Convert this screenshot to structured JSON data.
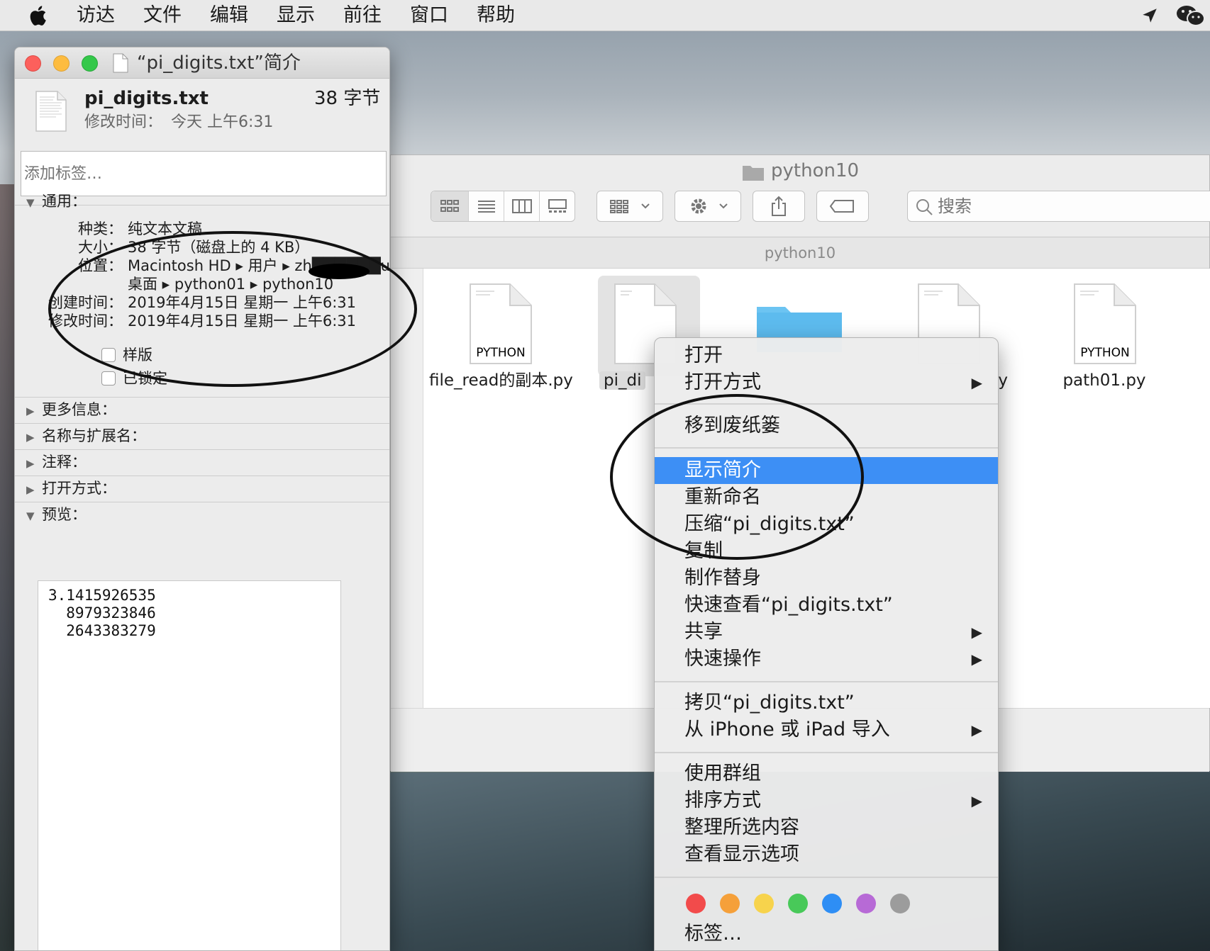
{
  "menubar": {
    "items": [
      "访达",
      "文件",
      "编辑",
      "显示",
      "前往",
      "窗口",
      "帮助"
    ]
  },
  "info_window": {
    "title": "“pi_digits.txt”简介",
    "file_name": "pi_digits.txt",
    "file_size": "38 字节",
    "modified_label": "修改时间：",
    "modified_value": "今天 上午6:31",
    "tag_placeholder": "添加标签…",
    "general": {
      "header": "通用：",
      "rows": [
        {
          "label": "种类：",
          "value": "纯文本文稿"
        },
        {
          "label": "大小：",
          "value": "38 字节（磁盘上的 4 KB）"
        },
        {
          "label": "位置：",
          "value": "Macintosh HD ▸ 用户 ▸ zh██████u ▸"
        },
        {
          "label": "",
          "value": "桌面 ▸ python01 ▸ python10"
        },
        {
          "label": "创建时间：",
          "value": "2019年4月15日 星期一 上午6:31"
        },
        {
          "label": "修改时间：",
          "value": "2019年4月15日 星期一 上午6:31"
        }
      ],
      "checkbox_stationery": "样版",
      "checkbox_locked": "已锁定"
    },
    "sections": [
      "更多信息：",
      "名称与扩展名：",
      "注释：",
      "打开方式："
    ],
    "preview_header": "预览：",
    "preview_text": "3.1415926535\n  8979323846\n  2643383279"
  },
  "finder": {
    "title": "python10",
    "path_bar": "python10",
    "search_placeholder": "搜索",
    "files": [
      {
        "name": "file_read的副本.py",
        "badge": "PYTHON"
      },
      {
        "name": "pi_di",
        "badge": ""
      },
      {
        "name": "",
        "badge": ""
      },
      {
        "name": "y",
        "badge": ""
      },
      {
        "name": "path01.py",
        "badge": "PYTHON"
      }
    ]
  },
  "context_menu": {
    "items": {
      "open": "打开",
      "open_with": "打开方式",
      "trash": "移到废纸篓",
      "get_info": "显示简介",
      "rename": "重新命名",
      "compress": "压缩“pi_digits.txt”",
      "duplicate": "复制",
      "alias": "制作替身",
      "quicklook": "快速查看“pi_digits.txt”",
      "share": "共享",
      "quick_actions": "快速操作",
      "copy": "拷贝“pi_digits.txt”",
      "import_iphone": "从 iPhone 或 iPad 导入",
      "use_groups": "使用群组",
      "sort_by": "排序方式",
      "clean_up": "整理所选内容",
      "view_options": "查看显示选项",
      "tags": "标签…"
    },
    "tag_colors": [
      "#f24b4b",
      "#f5a03a",
      "#f7d34c",
      "#48c959",
      "#2e8ef5",
      "#b76ad6",
      "#9c9c9c"
    ]
  },
  "colors": {
    "selection": "#3d8ff5",
    "folder": "#6cc4f2"
  }
}
